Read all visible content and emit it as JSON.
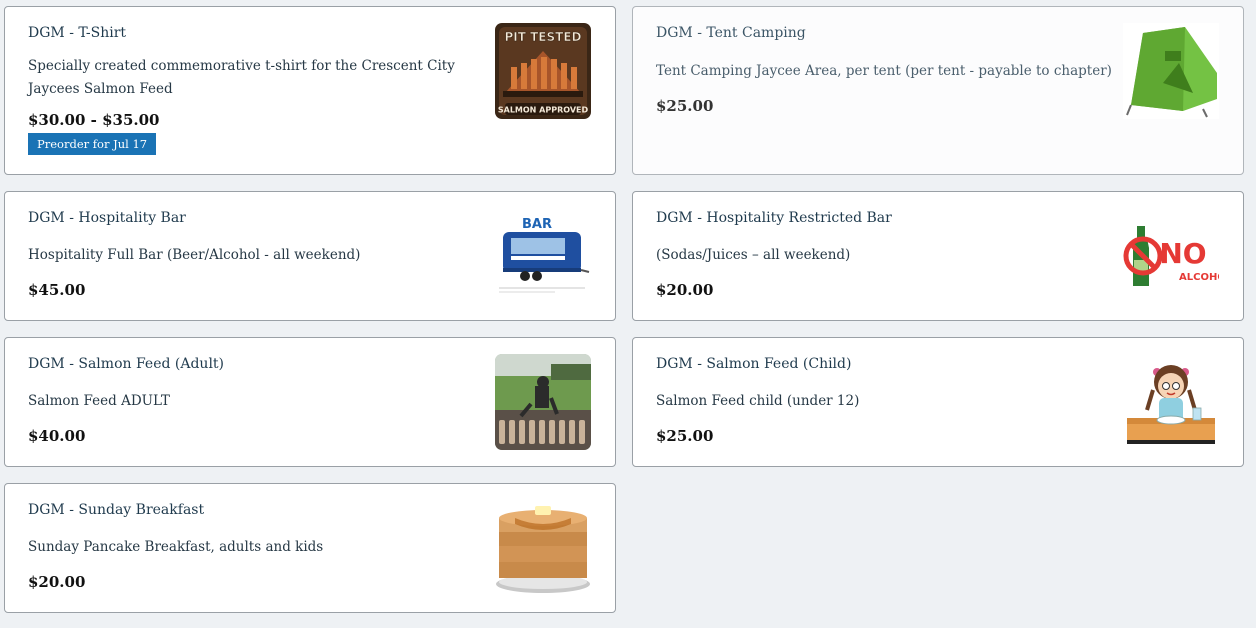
{
  "products": [
    {
      "title": "DGM - T-Shirt",
      "description": "Specially created commemorative t-shirt for the Crescent City Jaycees Salmon Feed",
      "price": "$30.00 - $35.00",
      "badge": "Preorder for Jul 17",
      "image": "pit-tested-tshirt-artwork",
      "image_text": [
        "PIT TESTED",
        "SALMON APPROVED"
      ]
    },
    {
      "title": "DGM - Tent Camping",
      "description": "Tent Camping Jaycee Area, per tent (per tent - payable to chapter)",
      "price": "$25.00",
      "image": "green-tent-icon"
    },
    {
      "title": "DGM - Hospitality Bar",
      "description": "Hospitality Full Bar (Beer/Alcohol - all weekend)",
      "price": "$45.00",
      "image": "bar-trailer-image",
      "image_text": [
        "BAR"
      ]
    },
    {
      "title": "DGM - Hospitality Restricted Bar",
      "description": "(Sodas/Juices – all weekend)",
      "price": "$20.00",
      "image": "no-alcohol-sign",
      "image_text": [
        "NO",
        "ALCOHOL"
      ]
    },
    {
      "title": "DGM - Salmon Feed (Adult)",
      "description": "Salmon Feed ADULT",
      "price": "$40.00",
      "image": "salmon-bbq-photo"
    },
    {
      "title": "DGM - Salmon Feed (Child)",
      "description": "Salmon Feed child (under 12)",
      "price": "$25.00",
      "image": "child-eating-illustration"
    },
    {
      "title": "DGM - Sunday Breakfast",
      "description": "Sunday Pancake Breakfast, adults and kids",
      "price": "$20.00",
      "image": "pancake-stack-icon"
    }
  ],
  "colors": {
    "page_background": "#eef1f4",
    "card_border": "#9aa0a6",
    "badge_background": "#1a73b5",
    "title_text": "#1f3a4d"
  }
}
